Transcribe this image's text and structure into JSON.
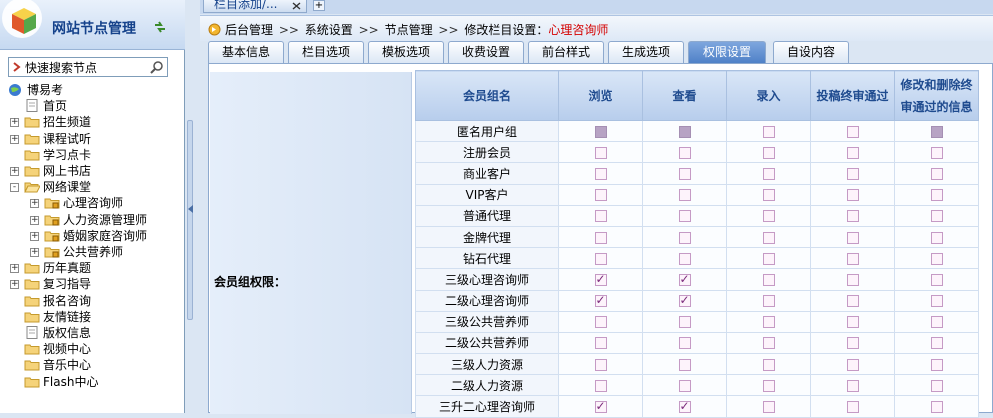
{
  "left_panel": {
    "title": "网站节点管理",
    "search": {
      "placeholder": "",
      "value": "快速搜索节点"
    },
    "tree": [
      {
        "label": "博易考",
        "level": 0,
        "icon": "site-globe-icon",
        "expander": ""
      },
      {
        "label": "首页",
        "level": 1,
        "icon": "page-icon",
        "expander": ""
      },
      {
        "label": "招生频道",
        "level": 1,
        "icon": "folder-icon",
        "expander": "+"
      },
      {
        "label": "课程试听",
        "level": 1,
        "icon": "folder-icon",
        "expander": "+"
      },
      {
        "label": "学习点卡",
        "level": 1,
        "icon": "folder-icon",
        "expander": ""
      },
      {
        "label": "网上书店",
        "level": 1,
        "icon": "folder-icon",
        "expander": "+"
      },
      {
        "label": "网络课堂",
        "level": 1,
        "icon": "folder-open-icon",
        "expander": "-"
      },
      {
        "label": "心理咨询师",
        "level": 2,
        "icon": "locked-folder-icon",
        "expander": "+"
      },
      {
        "label": "人力资源管理师",
        "level": 2,
        "icon": "locked-folder-icon",
        "expander": "+"
      },
      {
        "label": "婚姻家庭咨询师",
        "level": 2,
        "icon": "locked-folder-icon",
        "expander": "+"
      },
      {
        "label": "公共营养师",
        "level": 2,
        "icon": "locked-folder-icon",
        "expander": "+"
      },
      {
        "label": "历年真题",
        "level": 1,
        "icon": "folder-icon",
        "expander": "+"
      },
      {
        "label": "复习指导",
        "level": 1,
        "icon": "folder-icon",
        "expander": "+"
      },
      {
        "label": "报名咨询",
        "level": 1,
        "icon": "folder-icon",
        "expander": ""
      },
      {
        "label": "友情链接",
        "level": 1,
        "icon": "folder-icon",
        "expander": ""
      },
      {
        "label": "版权信息",
        "level": 1,
        "icon": "page-icon",
        "expander": ""
      },
      {
        "label": "视频中心",
        "level": 1,
        "icon": "folder-icon",
        "expander": ""
      },
      {
        "label": "音乐中心",
        "level": 1,
        "icon": "folder-icon",
        "expander": ""
      },
      {
        "label": "Flash中心",
        "level": 1,
        "icon": "folder-icon",
        "expander": ""
      }
    ]
  },
  "top_tab": {
    "label": "栏目添加/..."
  },
  "breadcrumb": {
    "items": [
      "后台管理",
      "系统设置",
      "节点管理"
    ],
    "separator": ">>",
    "current_prefix": "修改栏目设置：",
    "current": "心理咨询师"
  },
  "tabs": [
    {
      "label": "基本信息",
      "active": false
    },
    {
      "label": "栏目选项",
      "active": false
    },
    {
      "label": "模板选项",
      "active": false
    },
    {
      "label": "收费设置",
      "active": false
    },
    {
      "label": "前台样式",
      "active": false
    },
    {
      "label": "生成选项",
      "active": false
    },
    {
      "label": "权限设置",
      "active": true
    },
    {
      "label": "自设内容",
      "active": false
    }
  ],
  "permissions": {
    "label": "会员组权限：",
    "columns": [
      "会员组名",
      "浏览",
      "查看",
      "录入",
      "投稿终审通过",
      "修改和删除终审通过的信息"
    ],
    "rows": [
      {
        "name": "匿名用户组",
        "cells": [
          "disabled",
          "disabled",
          "off",
          "off",
          "disabled"
        ]
      },
      {
        "name": "注册会员",
        "cells": [
          "off",
          "off",
          "off",
          "off",
          "off"
        ]
      },
      {
        "name": "商业客户",
        "cells": [
          "off",
          "off",
          "off",
          "off",
          "off"
        ]
      },
      {
        "name": "VIP客户",
        "cells": [
          "off",
          "off",
          "off",
          "off",
          "off"
        ]
      },
      {
        "name": "普通代理",
        "cells": [
          "off",
          "off",
          "off",
          "off",
          "off"
        ]
      },
      {
        "name": "金牌代理",
        "cells": [
          "off",
          "off",
          "off",
          "off",
          "off"
        ]
      },
      {
        "name": "钻石代理",
        "cells": [
          "off",
          "off",
          "off",
          "off",
          "off"
        ]
      },
      {
        "name": "三级心理咨询师",
        "cells": [
          "on",
          "on",
          "off",
          "off",
          "off"
        ]
      },
      {
        "name": "二级心理咨询师",
        "cells": [
          "on",
          "on",
          "off",
          "off",
          "off"
        ]
      },
      {
        "name": "三级公共营养师",
        "cells": [
          "off",
          "off",
          "off",
          "off",
          "off"
        ]
      },
      {
        "name": "二级公共营养师",
        "cells": [
          "off",
          "off",
          "off",
          "off",
          "off"
        ]
      },
      {
        "name": "三级人力资源",
        "cells": [
          "off",
          "off",
          "off",
          "off",
          "off"
        ]
      },
      {
        "name": "二级人力资源",
        "cells": [
          "off",
          "off",
          "off",
          "off",
          "off"
        ]
      },
      {
        "name": "三升二心理咨询师",
        "cells": [
          "on",
          "on",
          "off",
          "off",
          "off"
        ]
      }
    ]
  }
}
